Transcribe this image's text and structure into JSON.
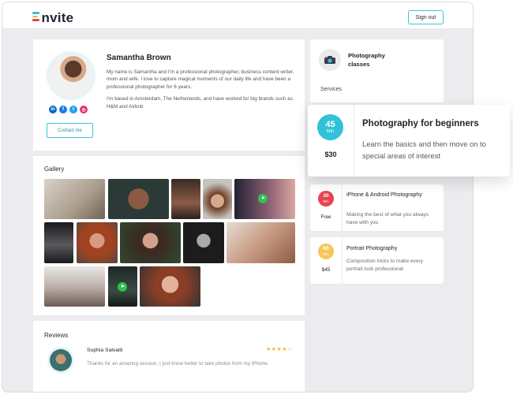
{
  "app": {
    "logo": "Envite",
    "logo_bar_colors": [
      "#2fc2d8",
      "#f5b72f",
      "#e8444f"
    ]
  },
  "header": {
    "signout_label": "Sign out"
  },
  "profile": {
    "name": "Samantha Brown",
    "bio_1": "My name is Samantha and I'm a professional photographer, business content writer, mom and wife. I love to capture magical moments of our daily life and have been a professional photographer for 6 years.",
    "bio_2": "I'm based in Amsterdam, The Netherlands, and have worked for big brands such as H&M and Airbnb",
    "socials": [
      {
        "icon": "linkedin-icon",
        "glyph": "in",
        "color": "#0a66c2"
      },
      {
        "icon": "facebook-icon",
        "glyph": "f",
        "color": "#1877f2"
      },
      {
        "icon": "twitter-icon",
        "glyph": "t",
        "color": "#1da1f2"
      },
      {
        "icon": "instagram-icon",
        "glyph": "◎",
        "color": "#e1306c"
      }
    ],
    "contact_label": "Contact me"
  },
  "gallery": {
    "title": "Gallery"
  },
  "reviews": {
    "title": "Reviews",
    "items": [
      {
        "name": "Sophia Salvatti",
        "stars": "★★★★☆",
        "text": "Thanks for an amazing session, I just know better to take photos from my iPhone."
      }
    ]
  },
  "classes": {
    "title": "Photography classes",
    "services_label": "Services"
  },
  "services": [
    {
      "duration": "45",
      "unit": "Min",
      "price": "$30",
      "title": "Photography for beginners",
      "desc": "Learn the basics and then move on to special areas of interest",
      "color": "#2fc2d8"
    },
    {
      "duration": "30",
      "unit": "Min",
      "price": "Free",
      "title": "iPhone & Android Photography",
      "desc": "Making the best of what you always have with you",
      "color": "#e8444f"
    },
    {
      "duration": "60",
      "unit": "Min",
      "price": "$45",
      "title": "Portrait Photography",
      "desc": "Composition tricks to make every portrait look professional",
      "color": "#f5c75a"
    }
  ]
}
